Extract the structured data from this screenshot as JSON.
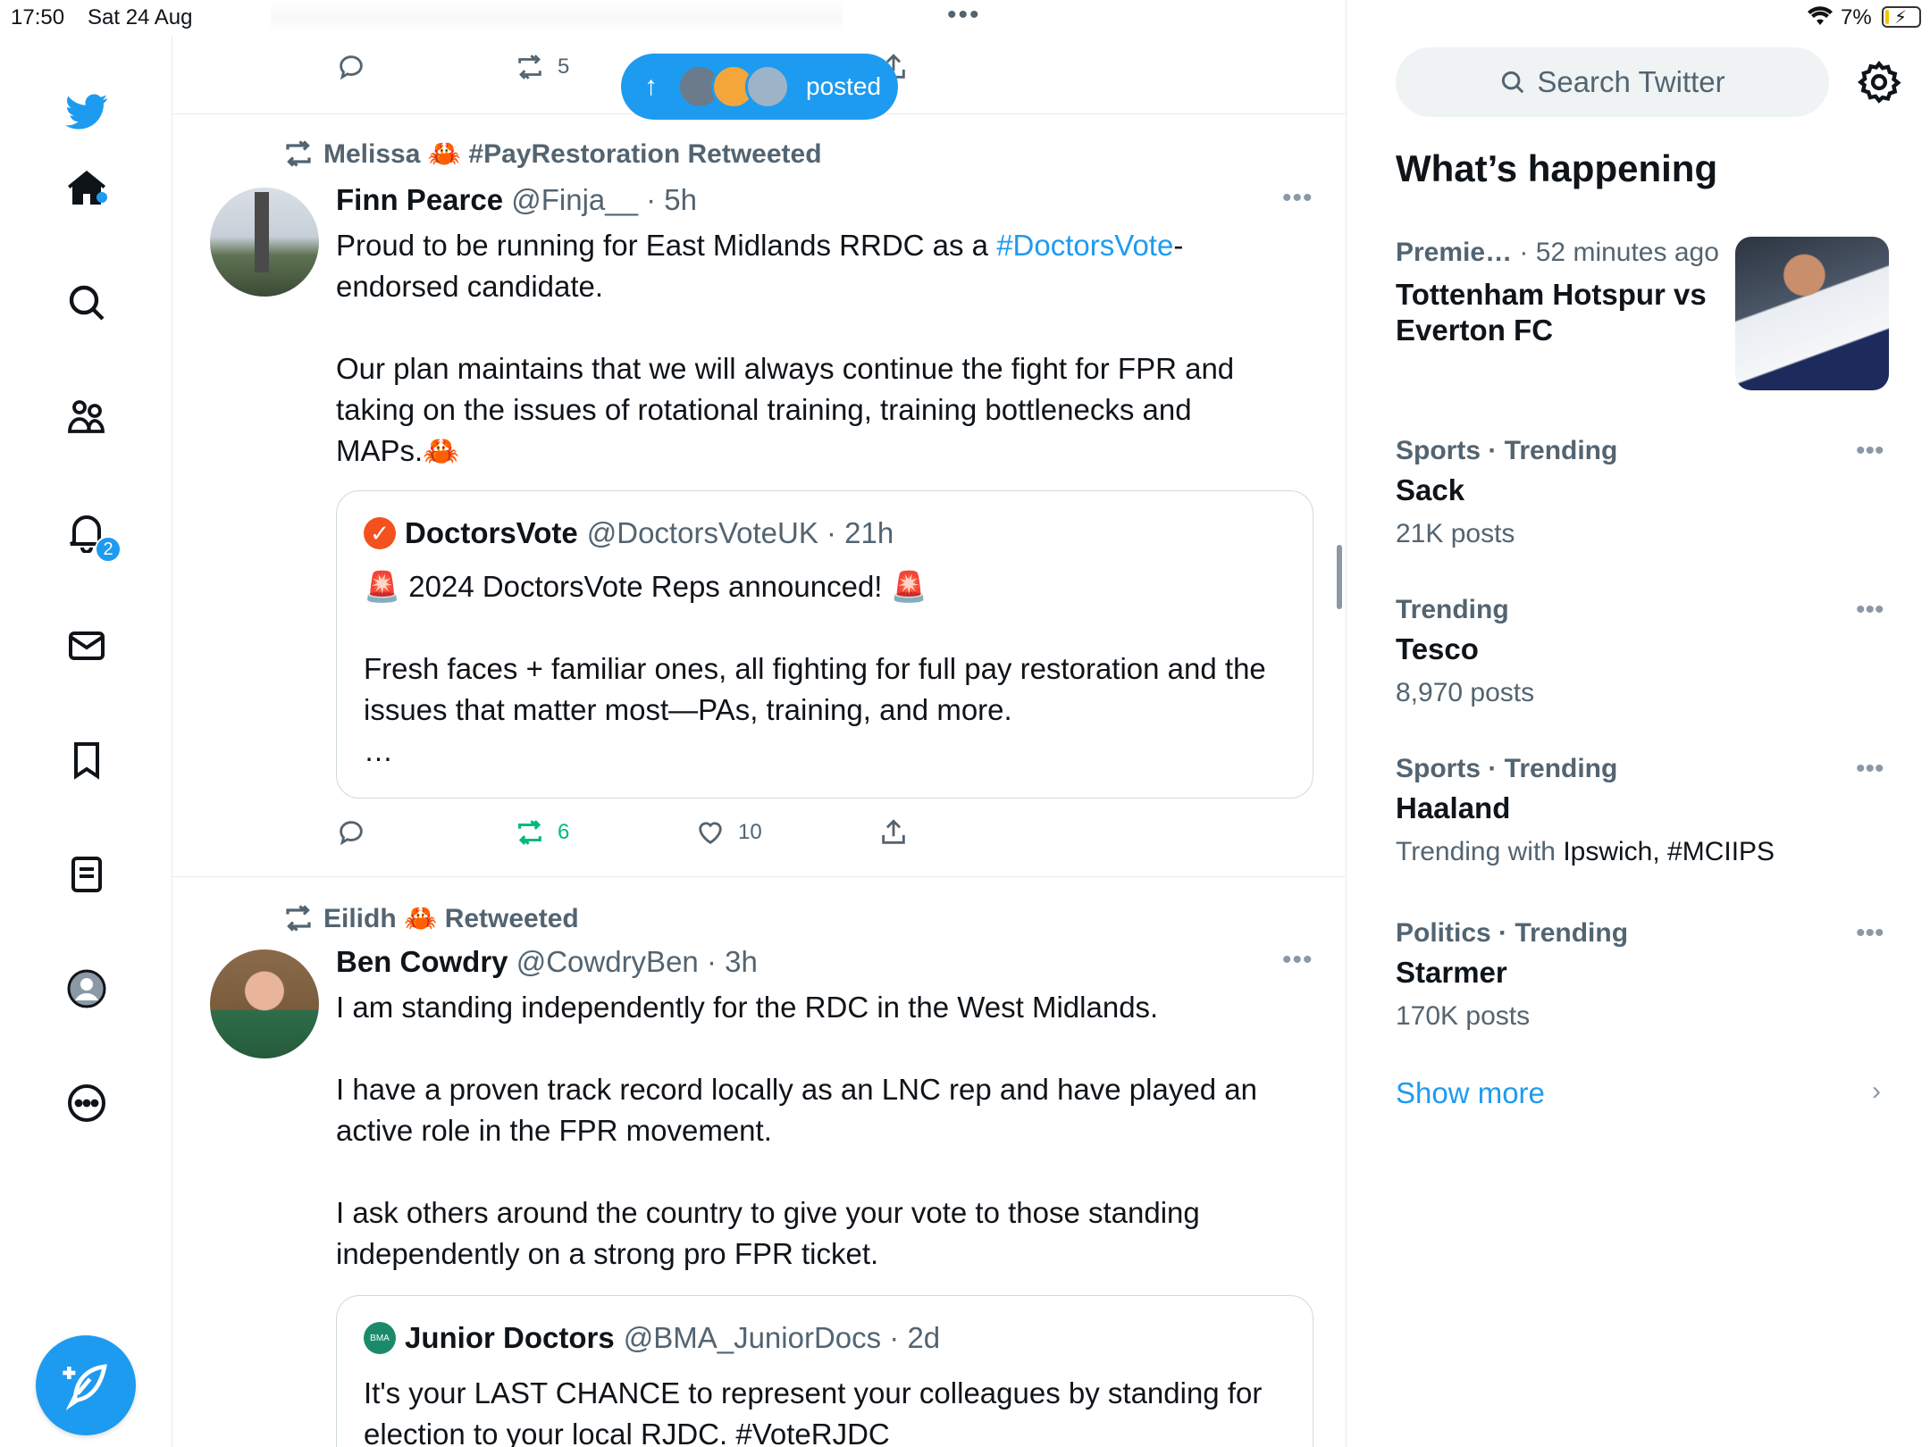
{
  "status_bar": {
    "time": "17:50",
    "date": "Sat 24 Aug",
    "battery": "7%"
  },
  "nav": {
    "items": [
      "home-icon",
      "search-icon",
      "communities-icon",
      "notifications-icon",
      "messages-icon",
      "bookmarks-icon",
      "lists-icon",
      "profile-icon",
      "more-icon"
    ],
    "notification_count": "2",
    "accent": "#1d9bf0"
  },
  "feed": {
    "top_actions": {
      "retweets": "5"
    },
    "new_posts_pill": {
      "label": "posted"
    },
    "tweets": [
      {
        "retweeted_by": "Melissa 🦀 #PayRestoration Retweeted",
        "name": "Finn Pearce",
        "handle_time": "@Finja__ · 5h",
        "text_before_link": "Proud to be running for East Midlands RRDC as a ",
        "link": "#DoctorsVote",
        "text_after_link": "-\nendorsed candidate.\n\nOur plan maintains that we will always continue the fight for FPR and taking on the issues of rotational training, training bottlenecks and MAPs.🦀",
        "quote": {
          "name": "DoctorsVote",
          "handle_time": "@DoctorsVoteUK · 21h",
          "text": "🚨 2024 DoctorsVote Reps announced! 🚨\n\nFresh faces + familiar ones, all fighting for full pay restoration and the issues that matter most—PAs, training, and more.\n…"
        },
        "retweets": "6",
        "likes": "10"
      },
      {
        "retweeted_by": "Eilidh 🦀 Retweeted",
        "name": "Ben Cowdry",
        "handle_time": "@CowdryBen · 3h",
        "text": "I am standing independently for the RDC in the West Midlands.\n\nI have a proven track record locally as an LNC rep and have played an active role in the FPR movement.\n\nI ask others around the country to give your vote to those standing independently on a strong pro FPR ticket.",
        "quote": {
          "name": "Junior Doctors",
          "handle_time": "@BMA_JuniorDocs · 2d",
          "text": "It's your LAST CHANCE to represent your colleagues by standing for election to your local RJDC. #VoteRJDC"
        }
      }
    ]
  },
  "sidebar": {
    "search_placeholder": "Search Twitter",
    "title": "What’s happening",
    "event": {
      "category": "Premie…",
      "time": "· 52 minutes ago",
      "title": "Tottenham Hotspur vs Everton FC"
    },
    "trends": [
      {
        "category": "Sports · Trending",
        "name": "Sack",
        "count": "21K posts"
      },
      {
        "category": "Trending",
        "name": "Tesco",
        "count": "8,970 posts"
      },
      {
        "category": "Sports · Trending",
        "name": "Haaland",
        "count_prefix": "Trending with ",
        "count": "Ipswich, #MCIIPS"
      },
      {
        "category": "Politics · Trending",
        "name": "Starmer",
        "count": "170K posts"
      }
    ],
    "show_more": "Show more"
  }
}
